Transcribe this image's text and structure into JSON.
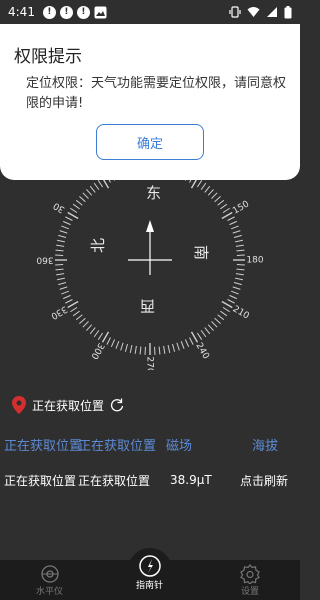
{
  "status_bar": {
    "time": "4:41",
    "notification_icons": [
      "alert-icon",
      "alert-icon",
      "alert-icon",
      "image-icon"
    ],
    "right_icons": [
      "vibrate-icon",
      "wifi-icon",
      "signal-icon",
      "battery-icon"
    ]
  },
  "dialog": {
    "title": "权限提示",
    "message": "定位权限：天气功能需要定位权限，请同意权限的申请!",
    "confirm_label": "确定",
    "accent": "#3a7ed6"
  },
  "compass": {
    "directions": {
      "north": "北",
      "east": "东",
      "south": "南",
      "west": "西"
    },
    "tick_labels": [
      "30",
      "150",
      "180",
      "210",
      "240",
      "270",
      "300",
      "330",
      "360"
    ]
  },
  "location": {
    "status": "正在获取位置",
    "pin_color": "#d32f2f"
  },
  "info_table": {
    "headers": [
      "正在获取位置",
      "正在获取位置",
      "磁场",
      "海拔"
    ],
    "values": [
      "正在获取位置",
      "正在获取位置",
      "38.9μT",
      "点击刷新"
    ],
    "header_color": "#5c8bd6"
  },
  "bottom_nav": {
    "items": [
      {
        "label": "水平仪",
        "icon": "level-icon",
        "active": false
      },
      {
        "label": "指南针",
        "icon": "compass-icon",
        "active": true
      },
      {
        "label": "设置",
        "icon": "gear-icon",
        "active": false
      }
    ]
  }
}
